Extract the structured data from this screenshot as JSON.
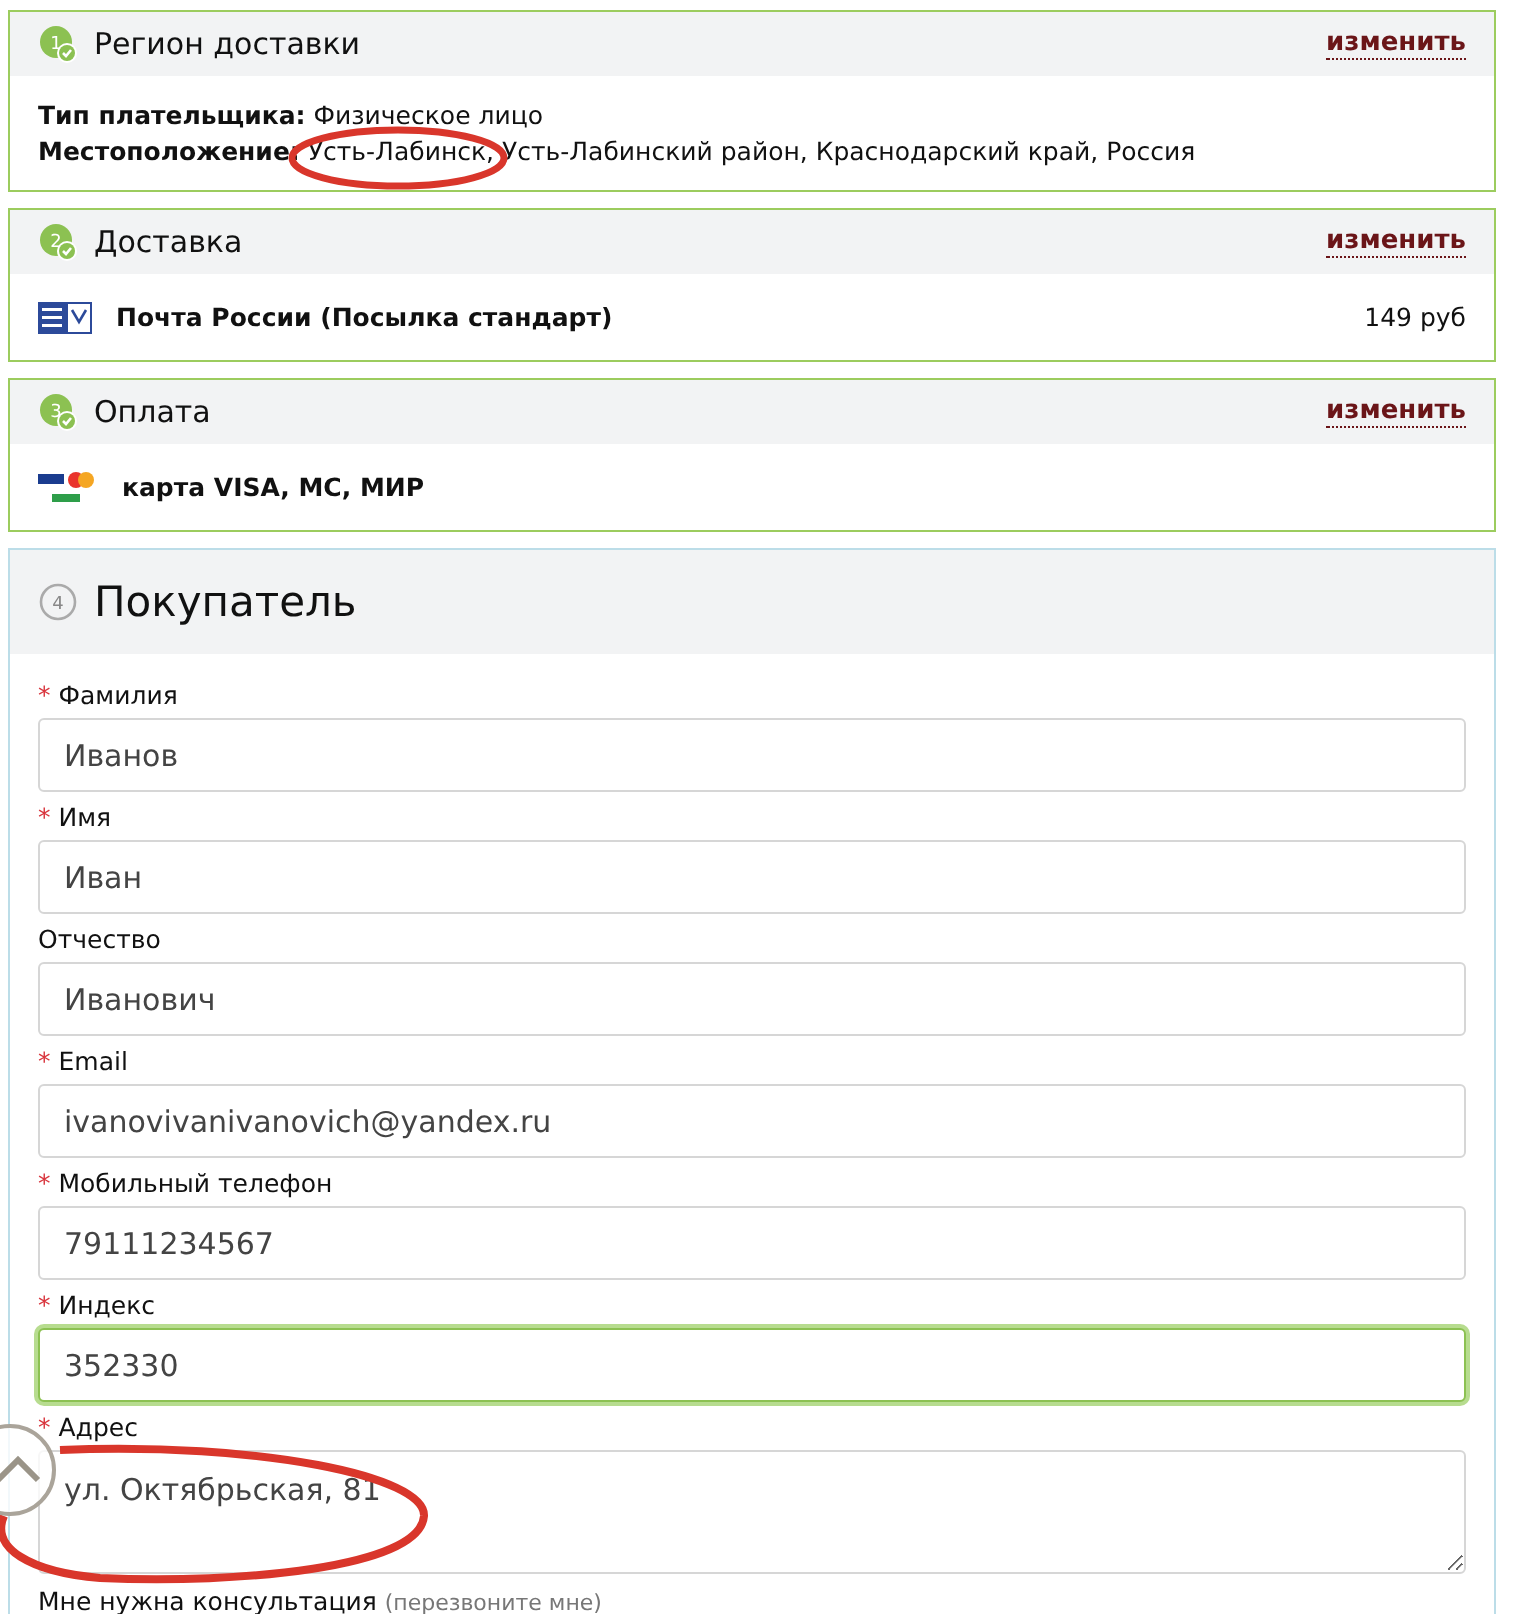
{
  "steps": [
    {
      "number": "1",
      "title": "Регион доставки",
      "completed": true,
      "change_link": "изменить",
      "kind": "region",
      "lines": [
        {
          "label": "Тип плательщика:",
          "value": "Физическое лицо"
        },
        {
          "label": "Местоположение:",
          "value": "Усть-Лабинск, Усть-Лабинский район, Краснодарский край, Россия"
        }
      ]
    },
    {
      "number": "2",
      "title": "Доставка",
      "completed": true,
      "change_link": "изменить",
      "kind": "delivery",
      "service": "Почта России (Посылка стандарт)",
      "price": "149 руб"
    },
    {
      "number": "3",
      "title": "Оплата",
      "completed": true,
      "change_link": "изменить",
      "kind": "payment",
      "method": "карта VISA, MC, МИР"
    }
  ],
  "buyer": {
    "number": "4",
    "title": "Покупатель",
    "completed": false,
    "fields": [
      {
        "marker": "*",
        "label": "Фамилия",
        "value": "Иванов",
        "focused": false,
        "kind": "input"
      },
      {
        "marker": "*",
        "label": "Имя",
        "value": "Иван",
        "focused": false,
        "kind": "input"
      },
      {
        "label": "Отчество",
        "value": "Иванович",
        "focused": false,
        "kind": "input"
      },
      {
        "marker": "*",
        "label": "Email",
        "value": "ivanovivanivanovich@yandex.ru",
        "focused": false,
        "kind": "input"
      },
      {
        "marker": "*",
        "label": "Мобильный телефон",
        "value": "79111234567",
        "focused": false,
        "kind": "input"
      },
      {
        "marker": "*",
        "label": "Индекс",
        "value": "352330",
        "focused": true,
        "kind": "input"
      },
      {
        "marker": "*",
        "label": "Адрес",
        "value": "ул. Октябрьская, 81",
        "focused": false,
        "kind": "textarea"
      }
    ],
    "consult": {
      "label": "Мне нужна консультация",
      "hint": "(перезвоните мне)"
    }
  }
}
